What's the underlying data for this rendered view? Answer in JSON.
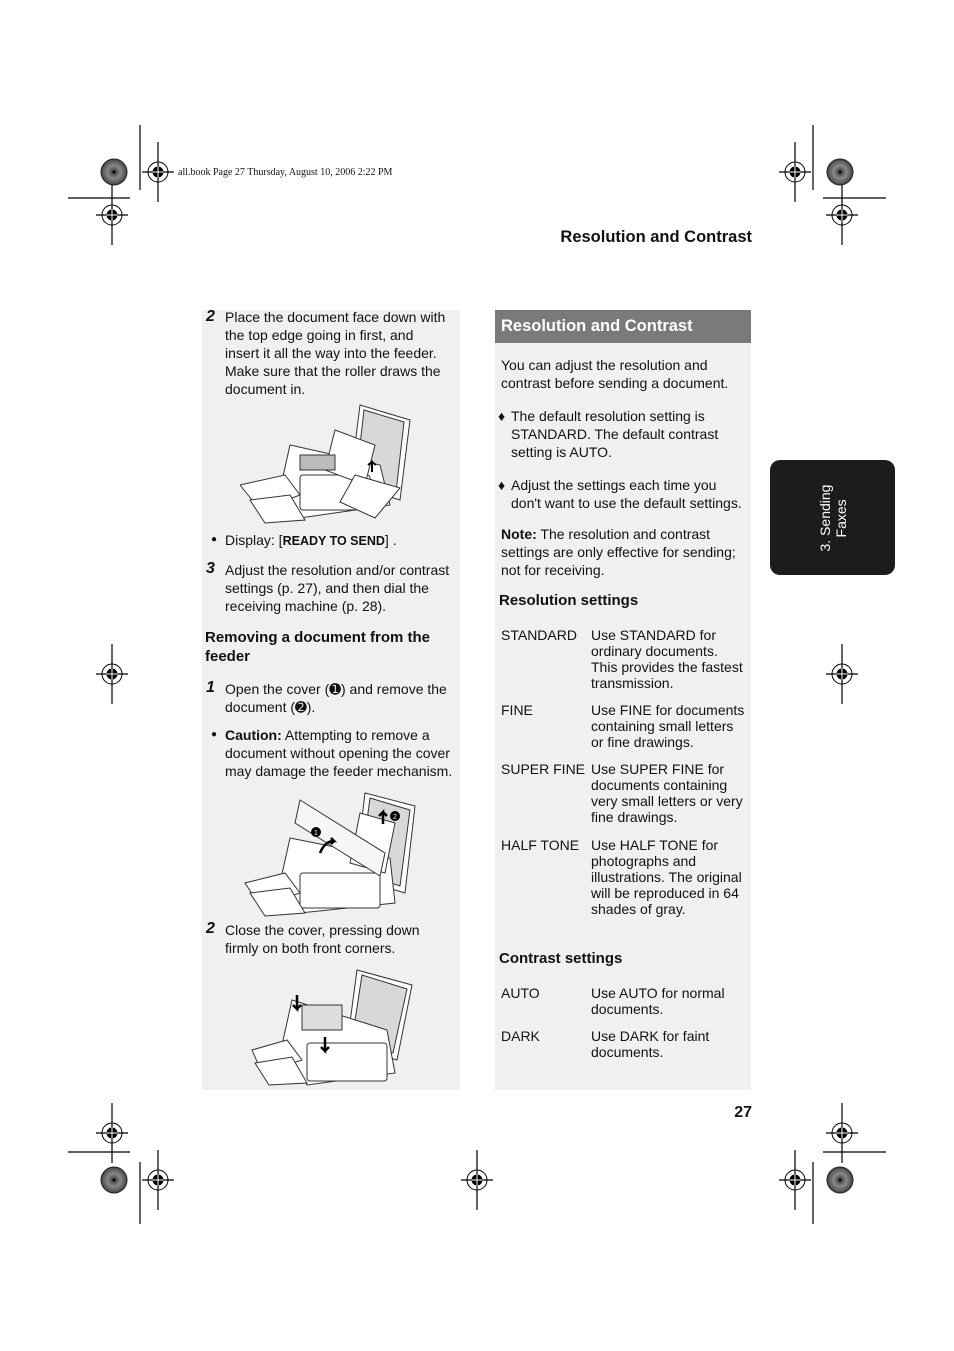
{
  "slug": "all.book  Page 27  Thursday, August 10, 2006  2:22 PM",
  "running_head": "Resolution and Contrast",
  "page_number": "27",
  "side_tab": {
    "line1": "3. Sending",
    "line2": "Faxes"
  },
  "left": {
    "step2_num": "2",
    "step2_lines": [
      "Place the document face down with",
      "the top edge going in first, and",
      "insert it all the way into the feeder.",
      "Make sure that the roller draws the",
      "document in."
    ],
    "display_prefix": "Display: [",
    "display_value": "READY TO SEND",
    "display_suffix": "] .",
    "step3_num": "3",
    "step3_lines": [
      "Adjust the resolution and/or contrast",
      "settings (p. 27), and then dial the",
      "receiving machine (p. 28)."
    ],
    "removing_heading_lines": [
      "Removing a document from the",
      "feeder"
    ],
    "r_step1_num": "1",
    "r_step1_lines": [
      "Open the cover (➊) and remove the",
      "document (➋)."
    ],
    "caution_label": "Caution:",
    "caution_lines": [
      " Attempting to remove a",
      "document without opening the cover",
      "may damage the feeder mechanism."
    ],
    "r_step2_num": "2",
    "r_step2_lines": [
      "Close the cover, pressing down",
      "firmly on both front corners."
    ],
    "callout_1": "1",
    "callout_2": "2"
  },
  "right": {
    "header": "Resolution and Contrast",
    "intro_lines": [
      "You can adjust the resolution and",
      "contrast before sending a document."
    ],
    "bullet_glyph": "♦",
    "bullets": [
      [
        "The default resolution setting is",
        "STANDARD. The default contrast",
        "setting is AUTO."
      ],
      [
        "Adjust the settings each time you",
        "don't want to use the default settings."
      ]
    ],
    "note_label": "Note:",
    "note_lines": [
      " The resolution and contrast",
      "settings are only effective for sending;",
      "not for receiving."
    ],
    "resolution_heading": "Resolution settings",
    "resolution_settings": [
      {
        "term": "STANDARD",
        "desc": [
          "Use STANDARD for",
          "ordinary documents.",
          "This provides the fastest",
          "transmission."
        ]
      },
      {
        "term": "FINE",
        "desc": [
          "Use FINE for documents",
          "containing small letters",
          "or fine drawings."
        ]
      },
      {
        "term": "SUPER FINE",
        "desc": [
          "Use SUPER FINE for",
          "documents containing",
          "very small letters or very",
          "fine drawings."
        ]
      },
      {
        "term": "HALF TONE",
        "desc": [
          "Use HALF TONE for",
          "photographs and",
          "illustrations. The original",
          "will be reproduced in 64",
          "shades of gray."
        ]
      }
    ],
    "contrast_heading": "Contrast settings",
    "contrast_settings": [
      {
        "term": "AUTO",
        "desc": [
          "Use AUTO for normal",
          "documents."
        ]
      },
      {
        "term": "DARK",
        "desc": [
          "Use DARK for faint",
          "documents."
        ]
      }
    ]
  },
  "colors": {
    "panel": "#f0f0f0",
    "header": "#7a7a7a",
    "tab": "#1c1c1c"
  }
}
